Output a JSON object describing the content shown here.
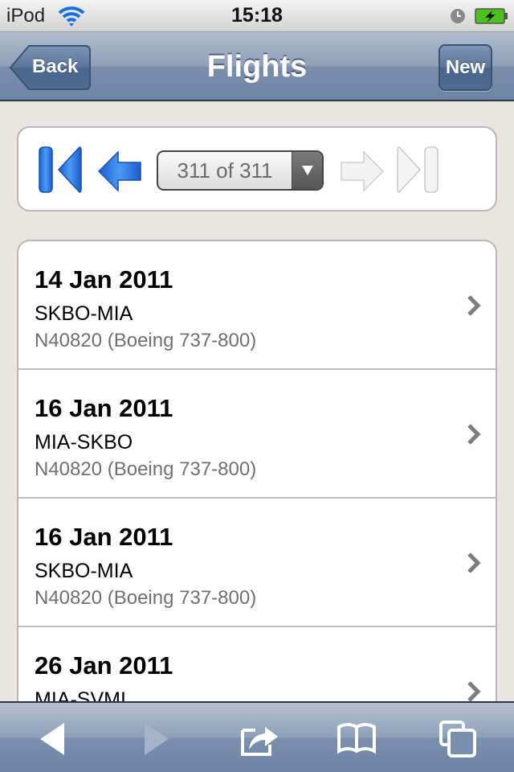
{
  "status_bar": {
    "carrier": "iPod",
    "time": "15:18",
    "icons": [
      "wifi-icon",
      "alarm-clock-icon",
      "battery-charging-icon"
    ]
  },
  "nav_bar": {
    "title": "Flights",
    "back_label": "Back",
    "new_label": "New"
  },
  "pager": {
    "first_icon": "first-page-icon",
    "prev_icon": "previous-arrow-icon",
    "current": "311 of 311",
    "next_icon": "next-arrow-icon",
    "last_icon": "last-page-icon",
    "next_enabled": false,
    "last_enabled": false
  },
  "flights": [
    {
      "date": "14 Jan 2011",
      "route": "SKBO-MIA",
      "aircraft": "N40820 (Boeing 737-800)"
    },
    {
      "date": "16 Jan 2011",
      "route": "MIA-SKBO",
      "aircraft": "N40820 (Boeing 737-800)"
    },
    {
      "date": "16 Jan 2011",
      "route": "SKBO-MIA",
      "aircraft": "N40820 (Boeing 737-800)"
    },
    {
      "date": "26 Jan 2011",
      "route": "MIA-SVMI",
      "aircraft": ""
    }
  ],
  "toolbar": {
    "icons": [
      "browser-back-icon",
      "browser-forward-icon",
      "share-icon",
      "bookmarks-icon",
      "pages-icon"
    ]
  },
  "colors": {
    "nav_bar": "#7b8fab",
    "pager_active": "#1a6fe0",
    "secondary_text": "#707070"
  }
}
